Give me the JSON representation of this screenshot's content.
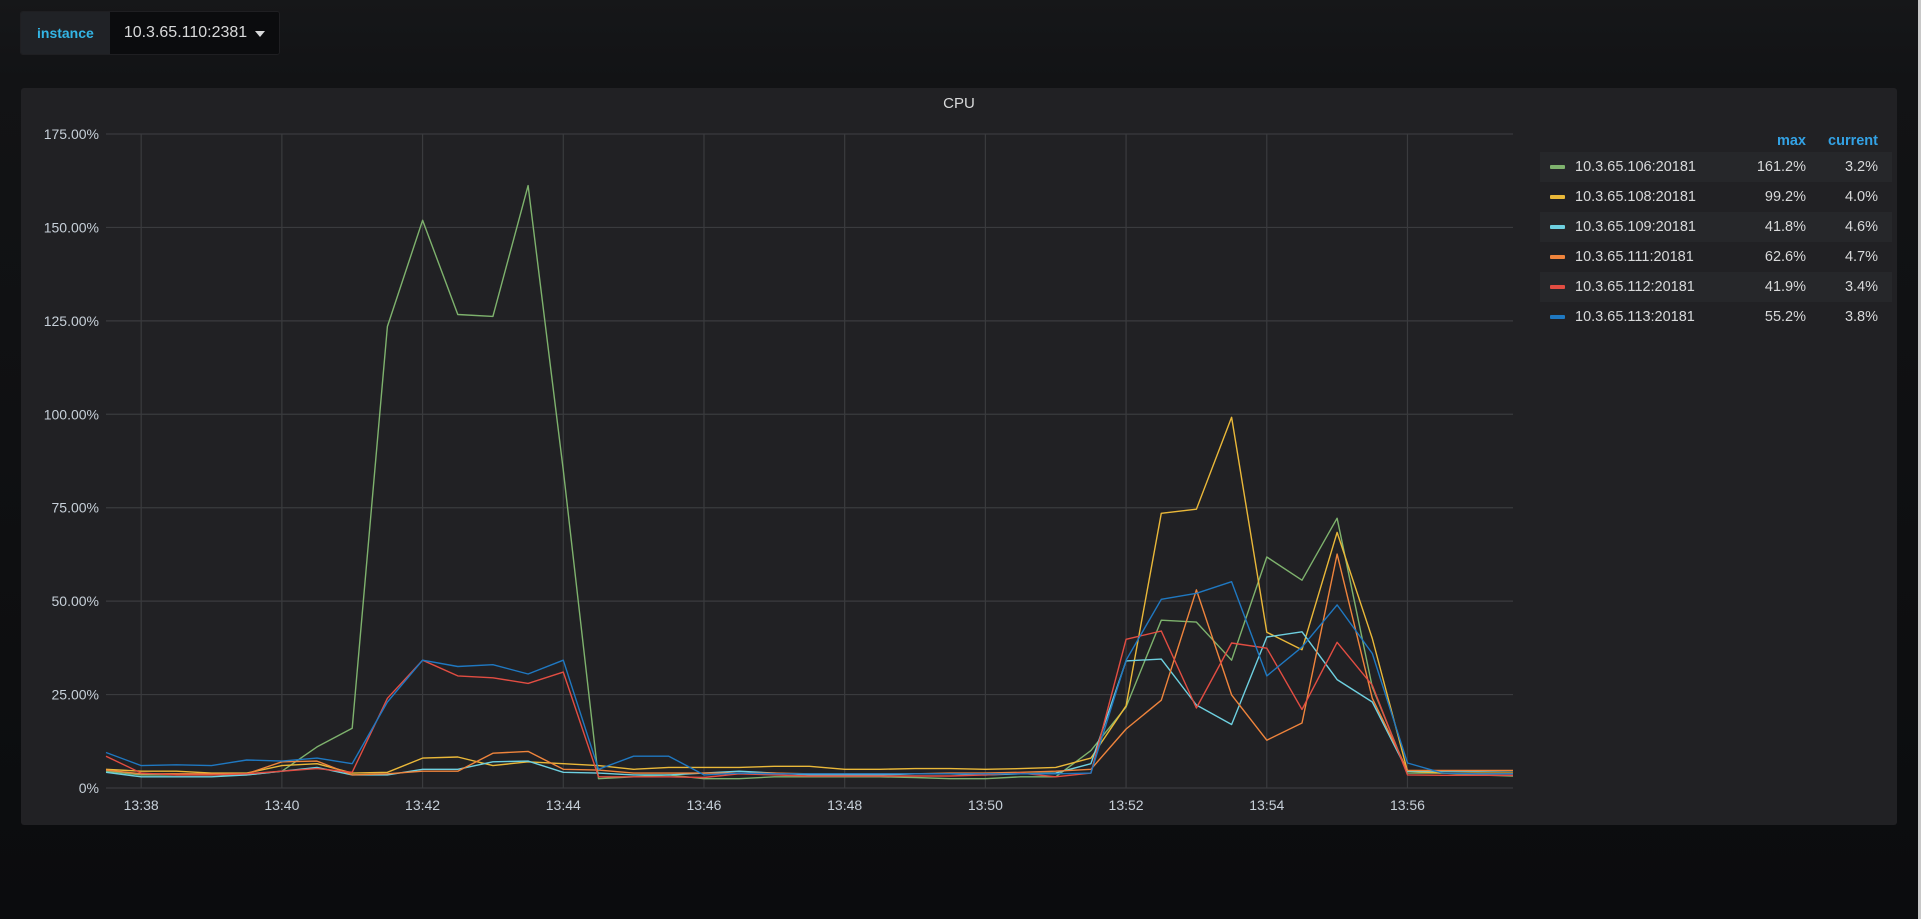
{
  "variable": {
    "label": "instance",
    "value": "10.3.65.110:2381"
  },
  "panel": {
    "title": "CPU"
  },
  "legend": {
    "max_header": "max",
    "current_header": "current",
    "items": [
      {
        "name": "10.3.65.106:20181",
        "color": "#7eb26d",
        "max": "161.2%",
        "current": "3.2%"
      },
      {
        "name": "10.3.65.108:20181",
        "color": "#eab839",
        "max": "99.2%",
        "current": "4.0%"
      },
      {
        "name": "10.3.65.109:20181",
        "color": "#6ed0e0",
        "max": "41.8%",
        "current": "4.6%"
      },
      {
        "name": "10.3.65.111:20181",
        "color": "#ef843c",
        "max": "62.6%",
        "current": "4.7%"
      },
      {
        "name": "10.3.65.112:20181",
        "color": "#e24d42",
        "max": "41.9%",
        "current": "3.4%"
      },
      {
        "name": "10.3.65.113:20181",
        "color": "#1f78c1",
        "max": "55.2%",
        "current": "3.8%"
      }
    ]
  },
  "chart_data": {
    "type": "line",
    "title": "CPU",
    "xlabel": "",
    "ylabel": "",
    "x_start": "13:37:30",
    "x_interval_seconds": 30,
    "x_ticks": [
      "13:38",
      "13:40",
      "13:42",
      "13:44",
      "13:46",
      "13:48",
      "13:50",
      "13:52",
      "13:54",
      "13:56"
    ],
    "y_ticks": [
      "0%",
      "25.00%",
      "50.00%",
      "75.00%",
      "100.00%",
      "125.00%",
      "150.00%",
      "175.00%"
    ],
    "ylim": [
      0,
      175
    ],
    "xlim_minutes": [
      -0.5,
      19.5
    ],
    "grid": true,
    "legend_position": "right",
    "series": [
      {
        "name": "10.3.65.106:20181",
        "color": "#7eb26d",
        "values": [
          4.5,
          3.5,
          3.5,
          3.5,
          3.5,
          4.5,
          11,
          16,
          123.5,
          151.9,
          126.7,
          126.2,
          161.2,
          85,
          2.5,
          3,
          3.5,
          2.5,
          2.5,
          3,
          3,
          3,
          3,
          2.8,
          2.5,
          2.5,
          3,
          3,
          10,
          21.7,
          44.9,
          44.4,
          34.2,
          61.8,
          55.6,
          72.2,
          27,
          4,
          4,
          3.5,
          3.2
        ]
      },
      {
        "name": "10.3.65.108:20181",
        "color": "#eab839",
        "values": [
          5,
          4.5,
          4.5,
          4,
          4,
          6,
          6.5,
          4,
          4.2,
          8,
          8.3,
          6,
          7,
          6.5,
          6,
          5,
          5.5,
          5.5,
          5.5,
          5.8,
          5.8,
          5,
          5,
          5.2,
          5.2,
          5,
          5.2,
          5.5,
          8,
          22,
          73.5,
          74.6,
          99.2,
          41.7,
          37,
          68.4,
          40,
          4.5,
          4,
          4,
          4
        ]
      },
      {
        "name": "10.3.65.109:20181",
        "color": "#6ed0e0",
        "values": [
          4.2,
          3,
          3,
          3,
          3.5,
          4.5,
          5.5,
          3.5,
          3.5,
          5,
          5,
          7,
          7.2,
          4.2,
          4,
          3.5,
          3.5,
          4,
          4.5,
          4,
          3.5,
          3.5,
          3.5,
          3.8,
          3.8,
          3.5,
          3.8,
          4,
          6.5,
          34,
          34.5,
          22.2,
          17,
          40.4,
          41.8,
          29,
          23,
          4.5,
          4.5,
          4.5,
          4.6
        ]
      },
      {
        "name": "10.3.65.111:20181",
        "color": "#ef843c",
        "values": [
          4.8,
          3.8,
          3.8,
          3.8,
          3.8,
          7,
          7.2,
          3.5,
          3.8,
          4.5,
          4.5,
          9.3,
          9.8,
          5,
          4.8,
          4,
          4,
          4,
          4,
          4,
          3.8,
          3.8,
          3.8,
          3.8,
          4,
          4,
          4.2,
          4.5,
          5,
          15.8,
          23.5,
          53,
          24.9,
          12.8,
          17.4,
          62.6,
          24,
          4.7,
          4.7,
          4.7,
          4.7
        ]
      },
      {
        "name": "10.3.65.112:20181",
        "color": "#e24d42",
        "values": [
          8.5,
          4,
          3.5,
          3.5,
          3.8,
          4.5,
          5.2,
          4.2,
          24,
          34.2,
          30,
          29.5,
          28,
          31,
          3,
          3,
          3,
          2.8,
          3.8,
          3.5,
          3.2,
          3.2,
          3.2,
          3.2,
          3.2,
          3.5,
          4,
          3,
          4,
          39.8,
          42,
          21.4,
          38.8,
          37.4,
          21,
          39,
          27.5,
          3.5,
          3.4,
          3.4,
          3.4
        ]
      },
      {
        "name": "10.3.65.113:20181",
        "color": "#1f78c1",
        "values": [
          9.5,
          6,
          6.2,
          6,
          7.5,
          7.2,
          8,
          6.5,
          23,
          34.2,
          32.5,
          33,
          30.5,
          34.2,
          5,
          8.5,
          8.5,
          3.5,
          4,
          3.8,
          3.8,
          3.8,
          3.8,
          3.8,
          3.8,
          3.8,
          3.8,
          3.8,
          4,
          34.2,
          50.5,
          52.1,
          55.2,
          30,
          37.7,
          49,
          36,
          6.7,
          4,
          3.8,
          3.8
        ]
      }
    ]
  }
}
